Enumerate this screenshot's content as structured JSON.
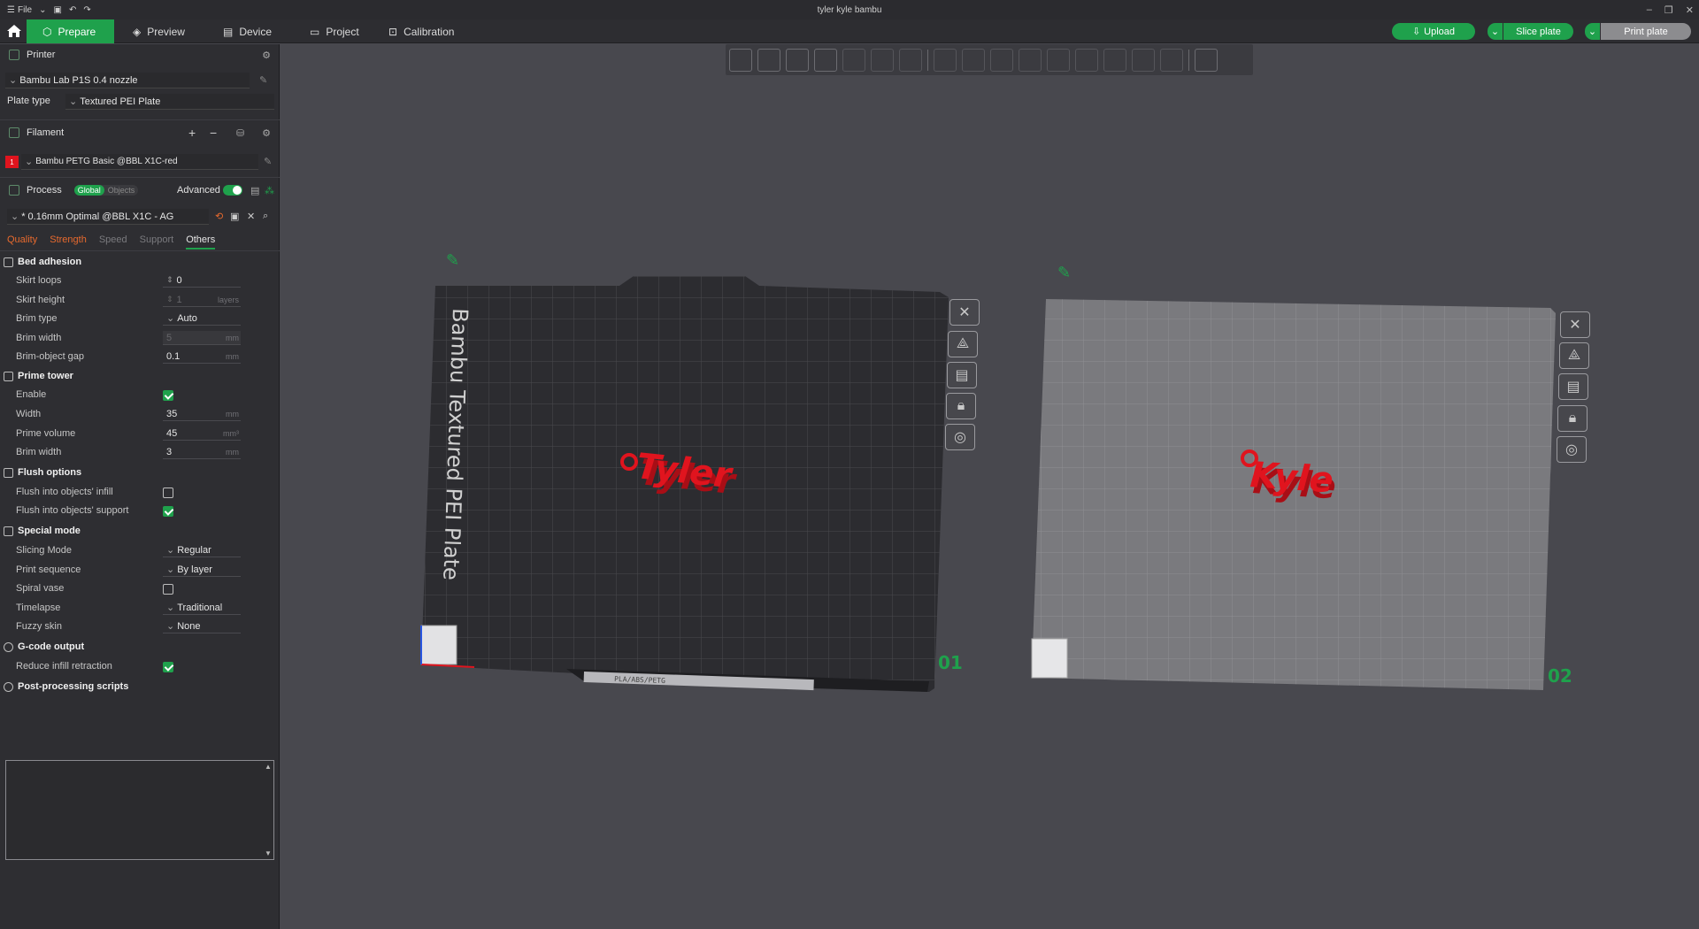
{
  "window": {
    "title": "tyler kyle bambu",
    "file_menu": "File"
  },
  "topbar": {
    "tabs": [
      {
        "label": "Prepare",
        "active": true
      },
      {
        "label": "Preview",
        "active": false
      },
      {
        "label": "Device",
        "active": false
      },
      {
        "label": "Project",
        "active": false
      },
      {
        "label": "Calibration",
        "active": false
      }
    ],
    "upload_label": "Upload",
    "slice_label": "Slice plate",
    "print_label": "Print plate"
  },
  "printer": {
    "section_label": "Printer",
    "name": "Bambu Lab P1S 0.4 nozzle",
    "plate_type_label": "Plate type",
    "plate_type_value": "Textured PEI Plate"
  },
  "filament": {
    "section_label": "Filament",
    "slot": "1",
    "name": "Bambu PETG Basic @BBL X1C-red",
    "color": "#e0141e"
  },
  "process": {
    "section_label": "Process",
    "toggle_global": "Global",
    "toggle_objects": "Objects",
    "advanced_label": "Advanced",
    "preset": "* 0.16mm Optimal @BBL X1C - AG",
    "tabs": [
      "Quality",
      "Strength",
      "Speed",
      "Support",
      "Others"
    ],
    "active_tab": "Others"
  },
  "groups": {
    "bed_adhesion": "Bed adhesion",
    "prime_tower": "Prime tower",
    "flush_options": "Flush options",
    "special_mode": "Special mode",
    "gcode_output": "G-code output",
    "post_processing": "Post-processing scripts"
  },
  "params": {
    "skirt_loops": {
      "label": "Skirt loops",
      "value": "0"
    },
    "skirt_height": {
      "label": "Skirt height",
      "value": "1",
      "unit": "layers"
    },
    "brim_type": {
      "label": "Brim type",
      "value": "Auto"
    },
    "brim_width": {
      "label": "Brim width",
      "value": "5",
      "unit": "mm"
    },
    "brim_object_gap": {
      "label": "Brim-object gap",
      "value": "0.1",
      "unit": "mm"
    },
    "enable": {
      "label": "Enable",
      "checked": true
    },
    "width": {
      "label": "Width",
      "value": "35",
      "unit": "mm"
    },
    "prime_volume": {
      "label": "Prime volume",
      "value": "45",
      "unit": "mm³"
    },
    "pt_brim_width": {
      "label": "Brim width",
      "value": "3",
      "unit": "mm"
    },
    "flush_infill": {
      "label": "Flush into objects' infill",
      "checked": false
    },
    "flush_support": {
      "label": "Flush into objects' support",
      "checked": true
    },
    "slicing_mode": {
      "label": "Slicing Mode",
      "value": "Regular"
    },
    "print_sequence": {
      "label": "Print sequence",
      "value": "By layer"
    },
    "spiral_vase": {
      "label": "Spiral vase",
      "checked": false
    },
    "timelapse": {
      "label": "Timelapse",
      "value": "Traditional"
    },
    "fuzzy_skin": {
      "label": "Fuzzy skin",
      "value": "None"
    },
    "reduce_infill_retraction": {
      "label": "Reduce infill retraction",
      "checked": true
    }
  },
  "plates": [
    {
      "number": "01",
      "plate_text": "Bambu Textured PEI Plate",
      "object_text": "Tyler",
      "sticker_text": "PLA/ABS/PETG"
    },
    {
      "number": "02",
      "object_text": "Kyle"
    }
  ],
  "colors": {
    "accent": "#1fa14c",
    "object": "#e0141e"
  }
}
